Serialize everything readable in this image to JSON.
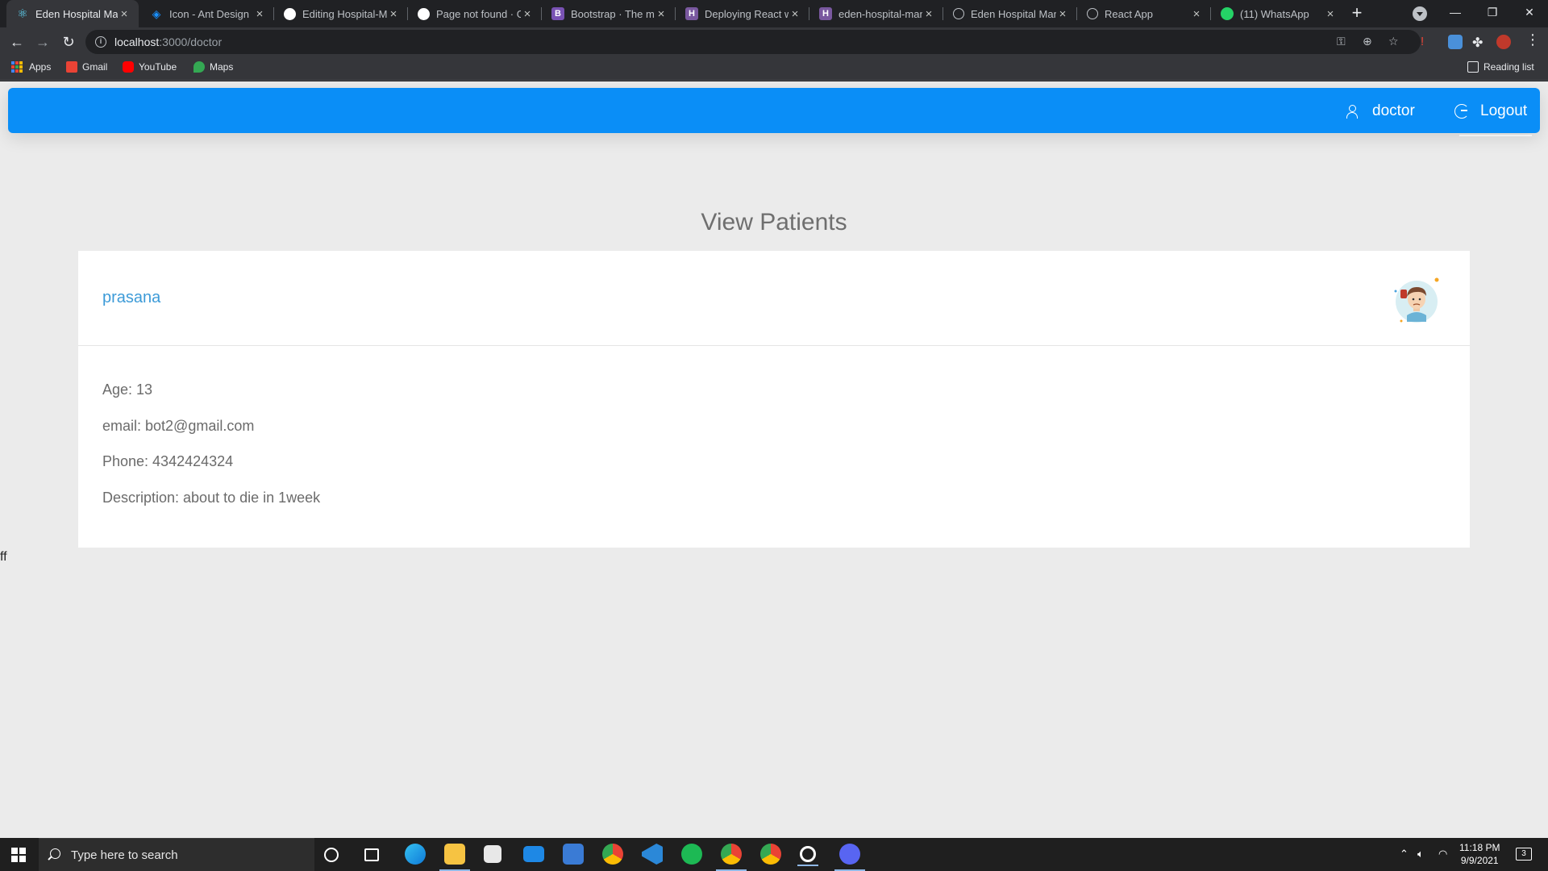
{
  "browser": {
    "tabs": [
      {
        "title": "Eden Hospital Man",
        "favicon": "react-icon",
        "color": "#61dafb",
        "active": true
      },
      {
        "title": "Icon - Ant Design",
        "favicon": "antd-icon",
        "color": "#1890ff",
        "active": false
      },
      {
        "title": "Editing Hospital-M",
        "favicon": "github-icon",
        "color": "#ffffff",
        "active": false
      },
      {
        "title": "Page not found · G",
        "favicon": "github-icon",
        "color": "#ffffff",
        "active": false
      },
      {
        "title": "Bootstrap · The mo",
        "favicon": "bootstrap-icon",
        "color": "#7952b3",
        "active": false
      },
      {
        "title": "Deploying React w",
        "favicon": "heroku-icon",
        "color": "#79589f",
        "active": false
      },
      {
        "title": "eden-hospital-man",
        "favicon": "heroku-icon",
        "color": "#79589f",
        "active": false
      },
      {
        "title": "Eden Hospital Man",
        "favicon": "globe-icon",
        "color": "#bdc1c6",
        "active": false
      },
      {
        "title": "React App",
        "favicon": "globe-icon",
        "color": "#bdc1c6",
        "active": false
      },
      {
        "title": "(11) WhatsApp",
        "favicon": "whatsapp-icon",
        "color": "#25d366",
        "active": false
      }
    ],
    "url_host": "localhost",
    "url_path": ":3000/doctor",
    "bookmarks": [
      {
        "label": "Apps",
        "icon": "apps-grid-icon"
      },
      {
        "label": "Gmail",
        "icon": "gmail-icon",
        "color": "#ea4335"
      },
      {
        "label": "YouTube",
        "icon": "youtube-icon",
        "color": "#ff0000"
      },
      {
        "label": "Maps",
        "icon": "maps-icon",
        "color": "#34a853"
      }
    ],
    "reading_list": "Reading list"
  },
  "app": {
    "accent": "#0a8ef7",
    "user_label": "doctor",
    "logout_label": "Logout",
    "page_title": "View Patients",
    "patient": {
      "name": "prasana",
      "age": "Age: 13",
      "email": "email: bot2@gmail.com",
      "phone": "Phone: 4342424324",
      "description": "Description: about to die in 1week"
    },
    "stray_text": "ff"
  },
  "taskbar": {
    "search_placeholder": "Type here to search",
    "time": "11:18 PM",
    "date": "9/9/2021",
    "notifications": "3"
  }
}
